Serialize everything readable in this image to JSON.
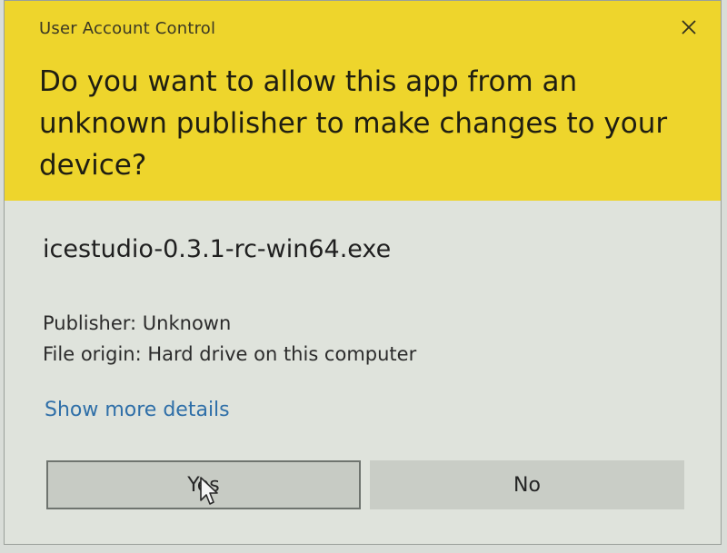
{
  "dialog": {
    "title": "User Account Control",
    "close_icon": "close-icon",
    "question": "Do you want to allow this app from an unknown publisher to make changes to your device?",
    "app_name": "icestudio-0.3.1-rc-win64.exe",
    "publisher": "Publisher: Unknown",
    "file_origin": "File origin: Hard drive on this computer",
    "details_link": "Show more details",
    "yes_label": "Yes",
    "no_label": "No",
    "cursor_icon": "mouse-pointer-icon"
  },
  "colors": {
    "header": "#eed52c",
    "body": "#dfe3dc",
    "link": "#2f6fa8"
  }
}
